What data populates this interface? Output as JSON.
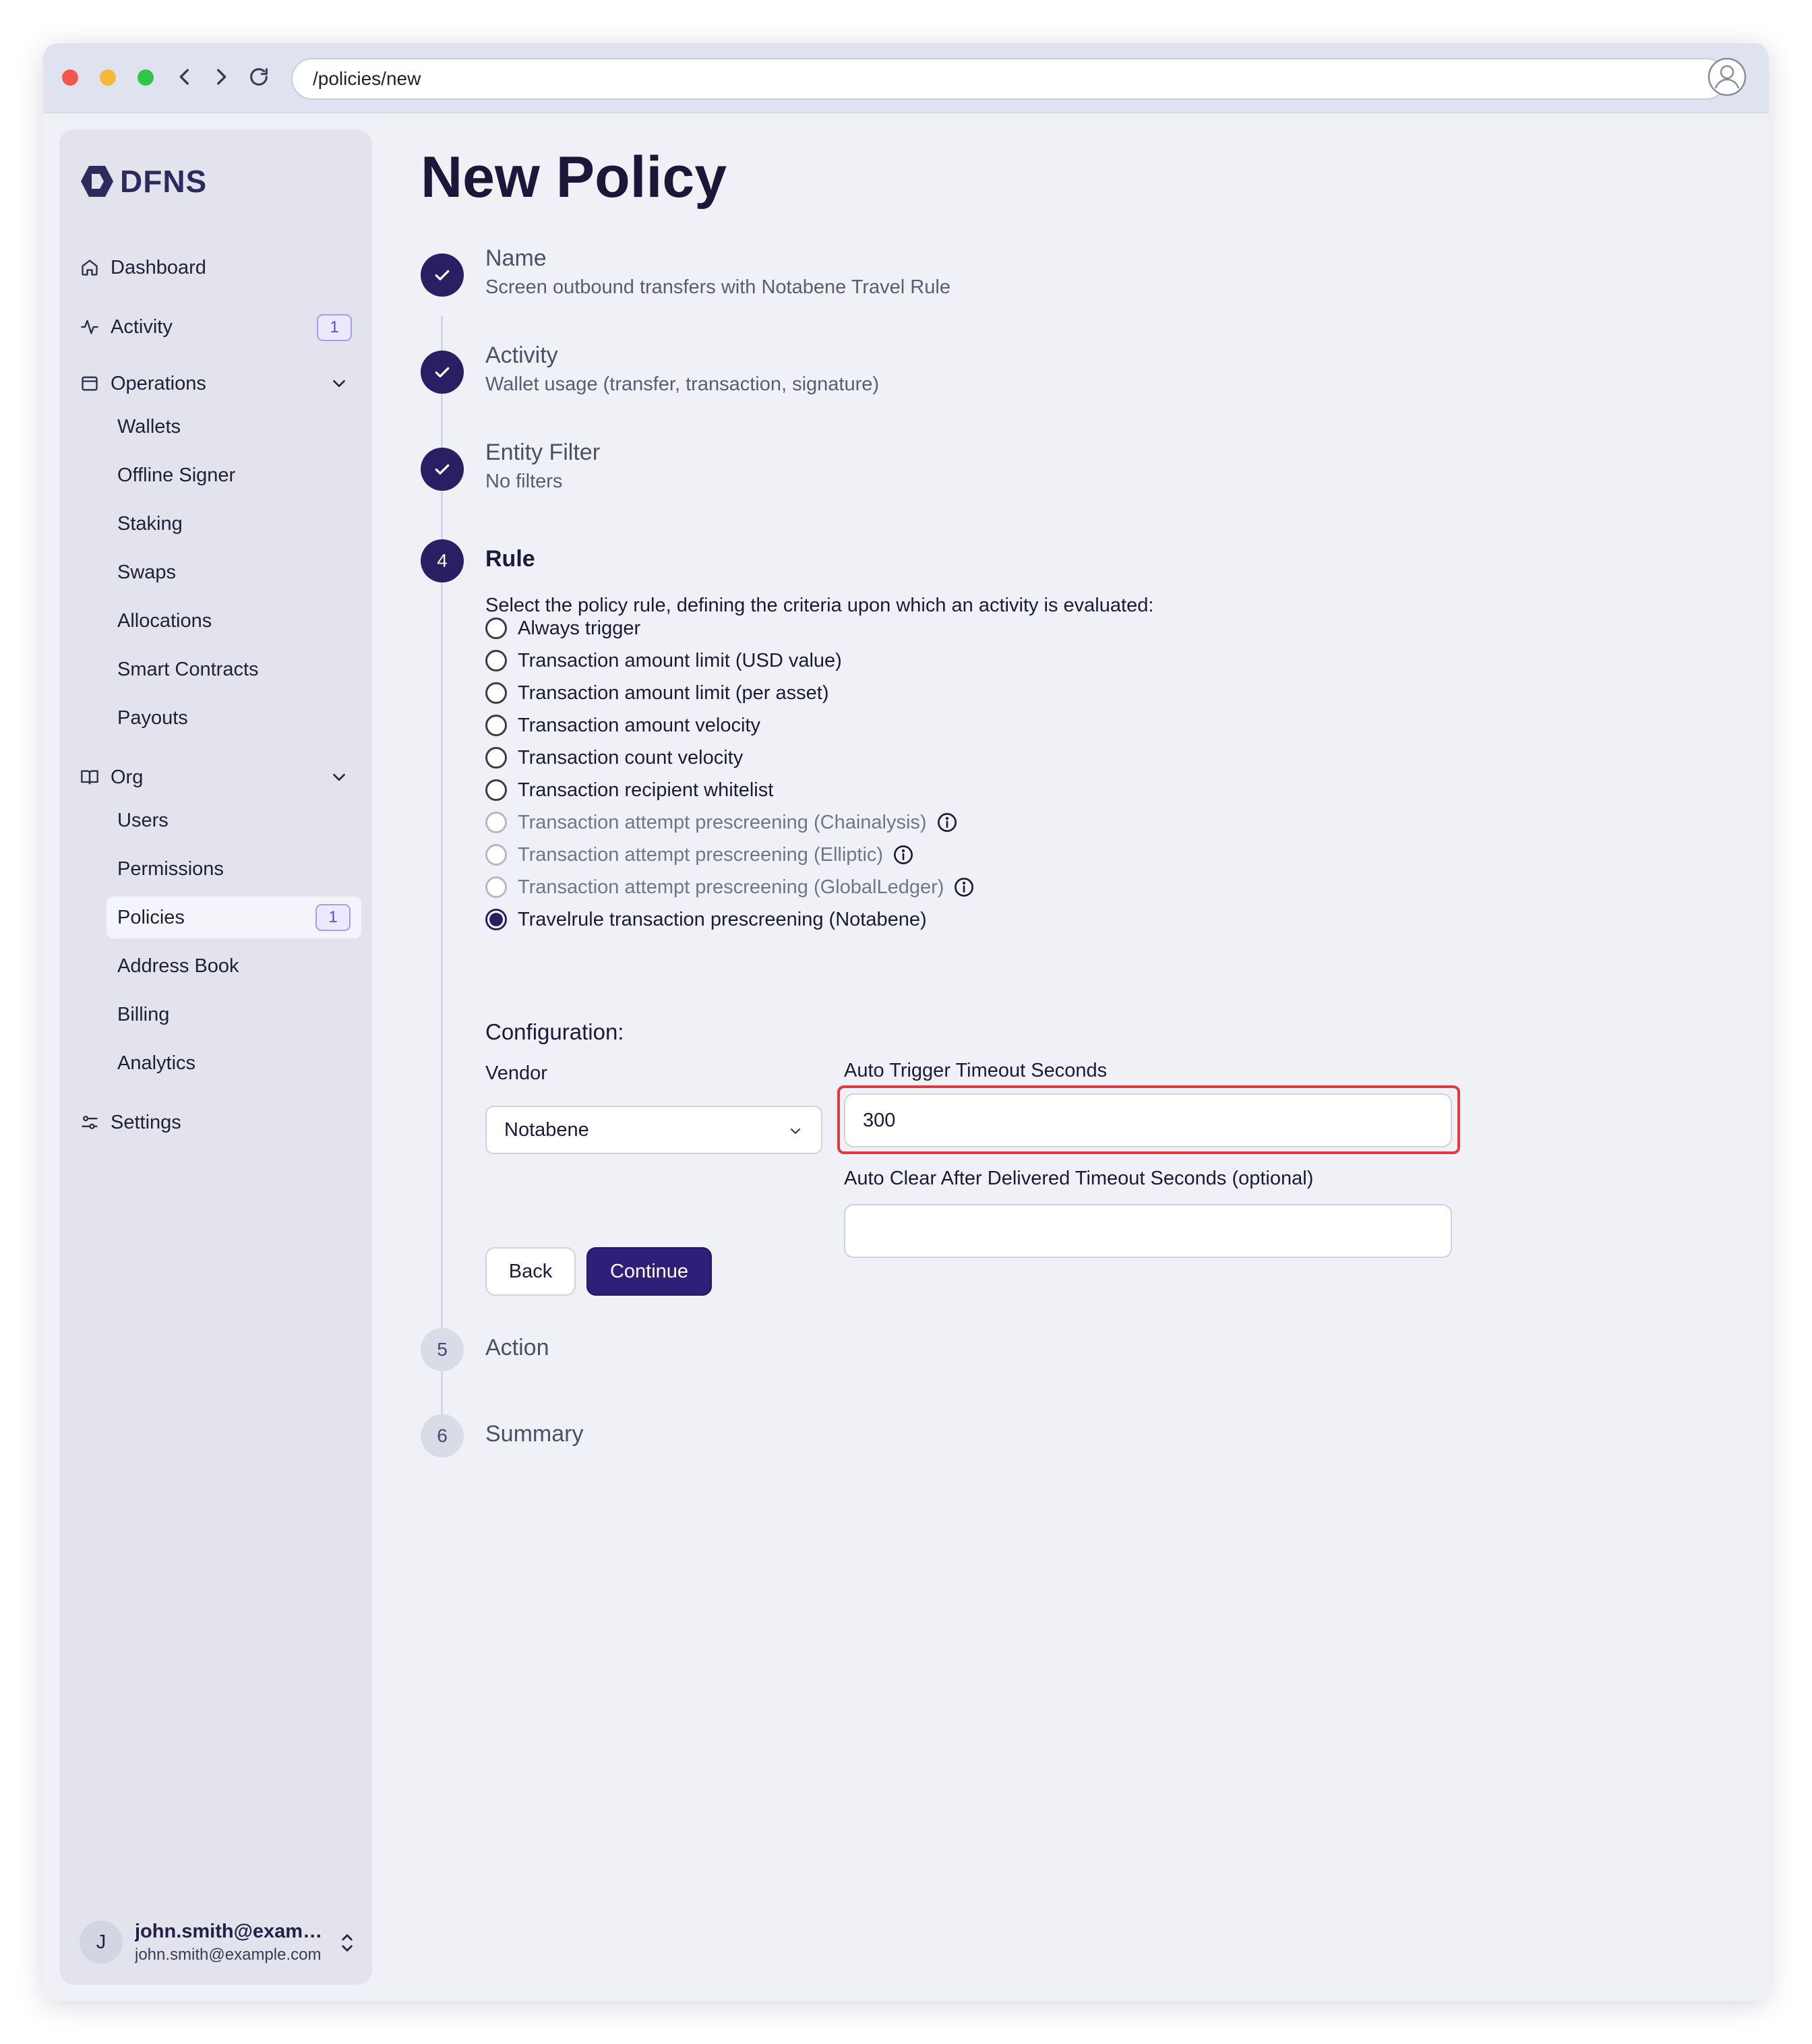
{
  "browser": {
    "url": "/policies/new"
  },
  "sidebar": {
    "logo_text": "DFNS",
    "nav": {
      "dashboard": "Dashboard",
      "activity": "Activity",
      "activity_badge": "1",
      "operations": "Operations",
      "org": "Org",
      "settings": "Settings"
    },
    "operations_items": [
      "Wallets",
      "Offline Signer",
      "Staking",
      "Swaps",
      "Allocations",
      "Smart Contracts",
      "Payouts"
    ],
    "org_items": [
      "Users",
      "Permissions",
      "Policies",
      "Address Book",
      "Billing",
      "Analytics"
    ],
    "policies_badge": "1",
    "user": {
      "initial": "J",
      "name": "john.smith@example.com",
      "email": "john.smith@example.com"
    }
  },
  "page": {
    "title": "New Policy"
  },
  "steps": [
    {
      "number": "1",
      "title": "Name",
      "subtitle": "Screen outbound transfers with Notabene Travel Rule",
      "state": "done"
    },
    {
      "number": "2",
      "title": "Activity",
      "subtitle": "Wallet usage (transfer, transaction, signature)",
      "state": "done"
    },
    {
      "number": "3",
      "title": "Entity Filter",
      "subtitle": "No filters",
      "state": "done"
    },
    {
      "number": "4",
      "title": "Rule",
      "subtitle": "",
      "state": "current"
    },
    {
      "number": "5",
      "title": "Action",
      "subtitle": "",
      "state": "pending"
    },
    {
      "number": "6",
      "title": "Summary",
      "subtitle": "",
      "state": "pending"
    }
  ],
  "rule": {
    "intro": "Select the policy rule, defining the criteria upon which an activity is evaluated:",
    "options": [
      {
        "label": "Always trigger",
        "disabled": false,
        "checked": false,
        "info": false
      },
      {
        "label": "Transaction amount limit (USD value)",
        "disabled": false,
        "checked": false,
        "info": false
      },
      {
        "label": "Transaction amount limit (per asset)",
        "disabled": false,
        "checked": false,
        "info": false
      },
      {
        "label": "Transaction amount velocity",
        "disabled": false,
        "checked": false,
        "info": false
      },
      {
        "label": "Transaction count velocity",
        "disabled": false,
        "checked": false,
        "info": false
      },
      {
        "label": "Transaction recipient whitelist",
        "disabled": false,
        "checked": false,
        "info": false
      },
      {
        "label": "Transaction attempt prescreening (Chainalysis)",
        "disabled": true,
        "checked": false,
        "info": true
      },
      {
        "label": "Transaction attempt prescreening (Elliptic)",
        "disabled": true,
        "checked": false,
        "info": true
      },
      {
        "label": "Transaction attempt prescreening (GlobalLedger)",
        "disabled": true,
        "checked": false,
        "info": true
      },
      {
        "label": "Travelrule transaction prescreening (Notabene)",
        "disabled": false,
        "checked": true,
        "info": false
      }
    ]
  },
  "config": {
    "title": "Configuration:",
    "vendor_label": "Vendor",
    "vendor_value": "Notabene",
    "auto_trigger_label": "Auto Trigger Timeout Seconds",
    "auto_trigger_value": "300",
    "auto_clear_label": "Auto Clear After Delivered Timeout Seconds (optional)",
    "auto_clear_value": ""
  },
  "buttons": {
    "back": "Back",
    "continue": "Continue"
  },
  "colors": {
    "accent": "#2a1f63",
    "highlight": "#e0393e",
    "badge": "#a79cf2"
  }
}
